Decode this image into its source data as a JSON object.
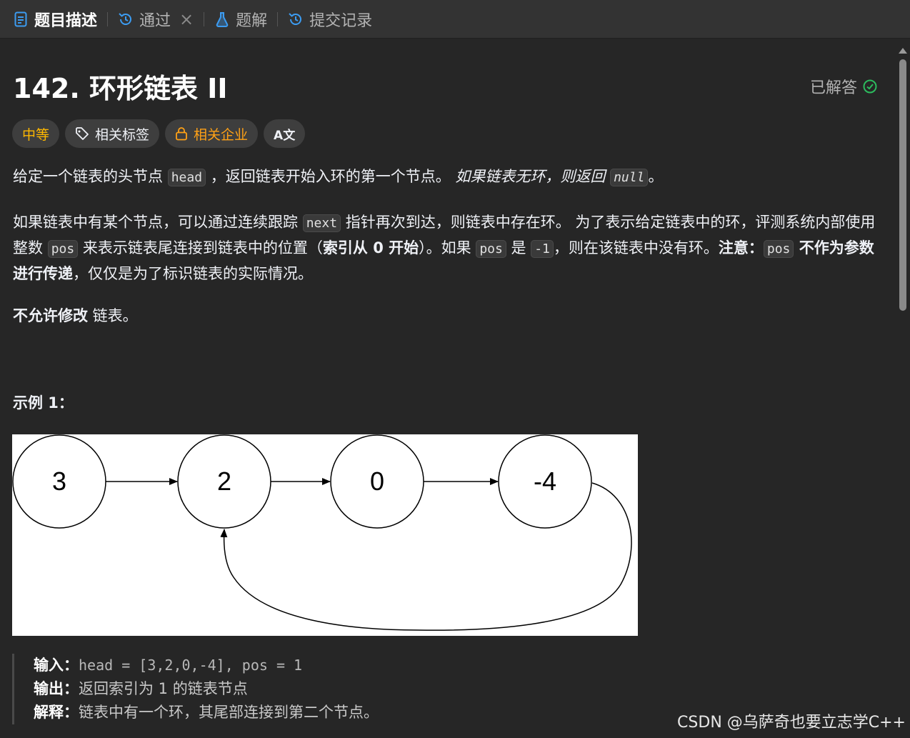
{
  "tabs": [
    {
      "label": "题目描述",
      "icon": "document-icon",
      "active": true
    },
    {
      "label": "通过",
      "icon": "history-icon",
      "closable": true
    },
    {
      "label": "题解",
      "icon": "flask-icon"
    },
    {
      "label": "提交记录",
      "icon": "history-icon"
    }
  ],
  "problem": {
    "title": "142. 环形链表 II",
    "status": "已解答",
    "difficulty": "中等",
    "tags_label": "相关标签",
    "company_label": "相关企业",
    "translate_label": "A文"
  },
  "description": {
    "p1_a": "给定一个链表的头节点 ",
    "p1_code1": "head",
    "p1_b": " ，返回链表开始入环的第一个节点。 ",
    "p1_italic": "如果链表无环，则返回 ",
    "p1_code2": "null",
    "p1_c": "。",
    "p2_a": "如果链表中有某个节点，可以通过连续跟踪 ",
    "p2_code1": "next",
    "p2_b": " 指针再次到达，则链表中存在环。 为了表示给定链表中的环，评测系统内部使用整数 ",
    "p2_code2": "pos",
    "p2_c": " 来表示链表尾连接到链表中的位置（",
    "p2_bold1": "索引从 0 开始",
    "p2_d": "）。如果 ",
    "p2_code3": "pos",
    "p2_e": " 是 ",
    "p2_code4": "-1",
    "p2_f": "，则在该链表中没有环。",
    "p2_bold2": "注意：",
    "p2_code5": "pos",
    "p2_bold3": " 不作为参数进行传递",
    "p2_g": "，仅仅是为了标识链表的实际情况。",
    "p3_bold": "不允许修改",
    "p3_rest": " 链表。"
  },
  "example": {
    "title": "示例 1：",
    "nodes": [
      "3",
      "2",
      "0",
      "-4"
    ],
    "input_label": "输入：",
    "input_value": "head = [3,2,0,-4], pos = 1",
    "output_label": "输出：",
    "output_value": "返回索引为 1 的链表节点",
    "explain_label": "解释：",
    "explain_value": "链表中有一个环，其尾部连接到第二个节点。"
  },
  "watermark": "CSDN @乌萨奇也要立志学C++",
  "colors": {
    "accent_blue": "#3c9cf2",
    "solved_green": "#2cbb5d",
    "difficulty": "#ffb800",
    "company": "#ffa116"
  }
}
